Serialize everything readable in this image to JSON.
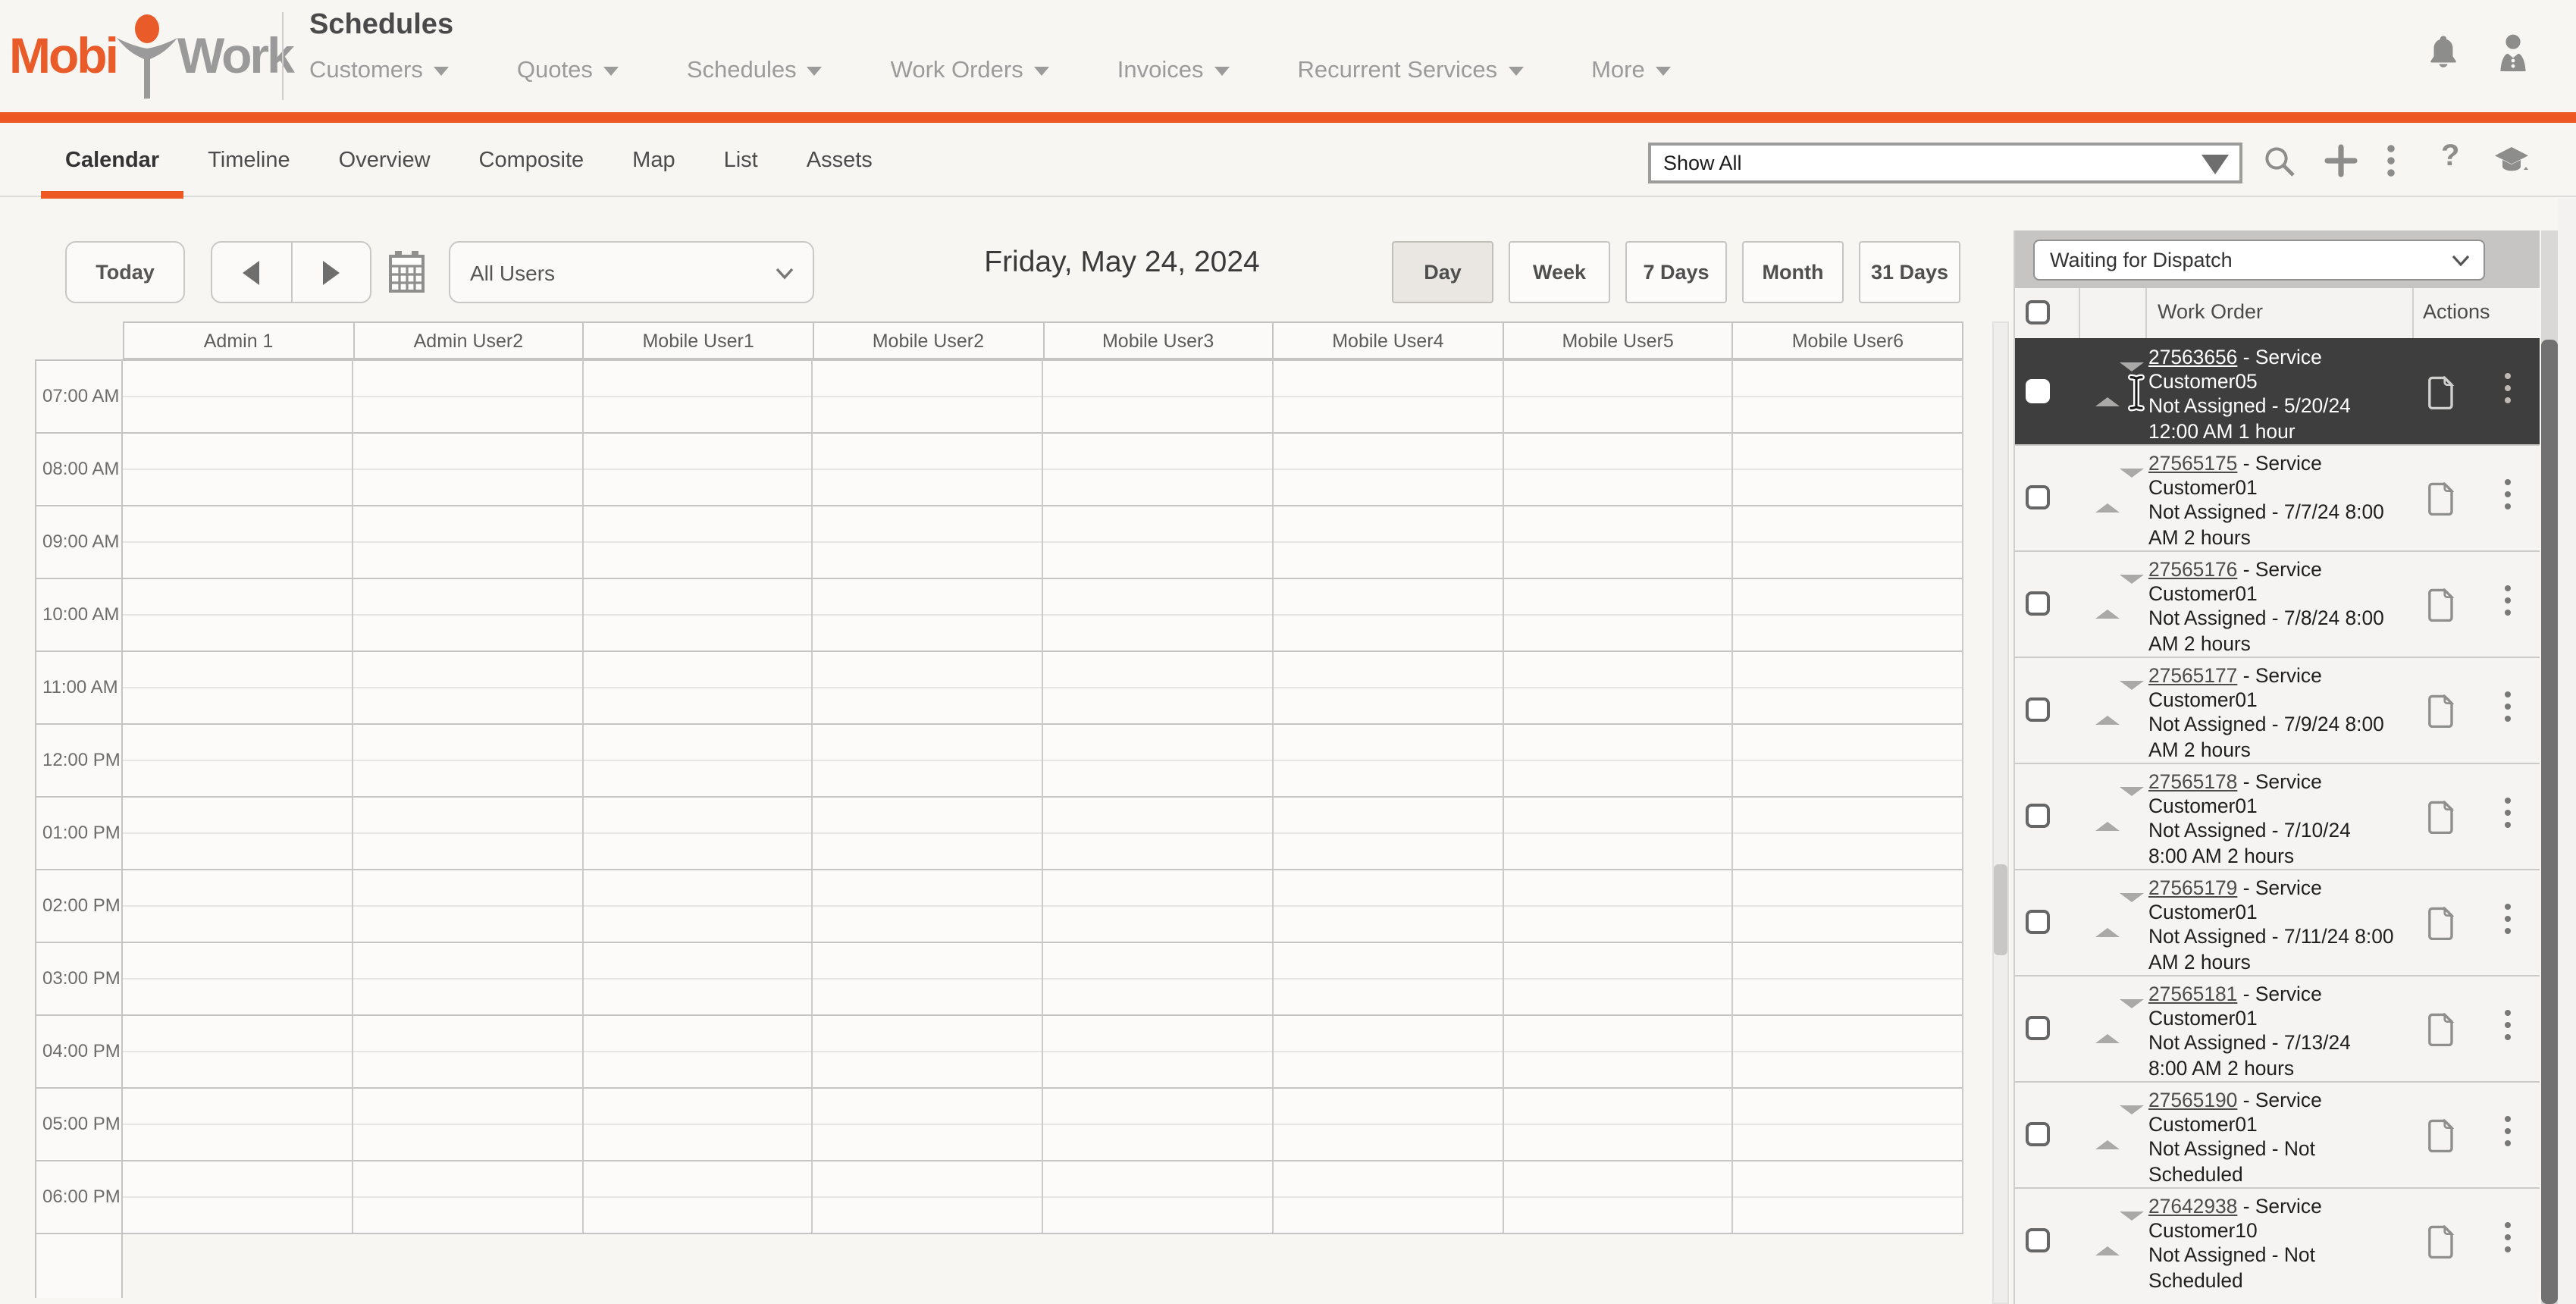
{
  "header": {
    "logo_mobi": "Mobi",
    "logo_work": "Work",
    "page_title": "Schedules",
    "nav": [
      "Customers",
      "Quotes",
      "Schedules",
      "Work Orders",
      "Invoices",
      "Recurrent Services",
      "More"
    ]
  },
  "tabs": [
    "Calendar",
    "Timeline",
    "Overview",
    "Composite",
    "Map",
    "List",
    "Assets"
  ],
  "filter_bar": {
    "show_all": "Show All"
  },
  "toolbar": {
    "today": "Today",
    "all_users": "All Users",
    "date_title": "Friday, May 24, 2024",
    "views": [
      "Day",
      "Week",
      "7 Days",
      "Month",
      "31 Days"
    ],
    "active_view": "Day"
  },
  "calendar": {
    "columns": [
      "Admin 1",
      "Admin User2",
      "Mobile User1",
      "Mobile User2",
      "Mobile User3",
      "Mobile User4",
      "Mobile User5",
      "Mobile User6"
    ],
    "times": [
      "07:00 AM",
      "08:00 AM",
      "09:00 AM",
      "10:00 AM",
      "11:00 AM",
      "12:00 PM",
      "01:00 PM",
      "02:00 PM",
      "03:00 PM",
      "04:00 PM",
      "05:00 PM",
      "06:00 PM"
    ]
  },
  "panel": {
    "filter": "Waiting for Dispatch",
    "header": {
      "work_order": "Work Order",
      "actions": "Actions"
    },
    "items": [
      {
        "id": "27563656",
        "rest": " - Service Customer05",
        "sched": "Not Assigned - 5/20/24 12:00 AM 1 hour",
        "selected": true
      },
      {
        "id": "27565175",
        "rest": " - Service Customer01",
        "sched": "Not Assigned - 7/7/24 8:00 AM 2 hours",
        "selected": false
      },
      {
        "id": "27565176",
        "rest": " - Service Customer01",
        "sched": "Not Assigned - 7/8/24 8:00 AM 2 hours",
        "selected": false
      },
      {
        "id": "27565177",
        "rest": " - Service Customer01",
        "sched": "Not Assigned - 7/9/24 8:00 AM 2 hours",
        "selected": false
      },
      {
        "id": "27565178",
        "rest": " - Service Customer01",
        "sched": "Not Assigned - 7/10/24 8:00 AM 2 hours",
        "selected": false
      },
      {
        "id": "27565179",
        "rest": " - Service Customer01",
        "sched": "Not Assigned - 7/11/24 8:00 AM 2 hours",
        "selected": false
      },
      {
        "id": "27565181",
        "rest": " - Service Customer01",
        "sched": "Not Assigned - 7/13/24 8:00 AM 2 hours",
        "selected": false
      },
      {
        "id": "27565190",
        "rest": " - Service Customer01",
        "sched": "Not Assigned - Not Scheduled",
        "selected": false
      },
      {
        "id": "27642938",
        "rest": " - Service Customer10",
        "sched": "Not Assigned - Not Scheduled",
        "selected": false
      }
    ]
  },
  "icons": {
    "bell": "notifications-icon",
    "person": "user-icon",
    "search": "search-icon",
    "plus": "add-icon",
    "kebab": "more-options-icon",
    "question": "help-icon",
    "cap": "training-icon",
    "calendar": "date-picker-icon",
    "prev": "previous-icon",
    "next": "next-icon",
    "drag": "drag-handle-icon",
    "doc": "document-icon"
  },
  "colors": {
    "accent": "#EC5723",
    "dark_row": "#3E3E3E",
    "logo_orange": "#E95B28",
    "logo_gray": "#9A9A9A"
  }
}
